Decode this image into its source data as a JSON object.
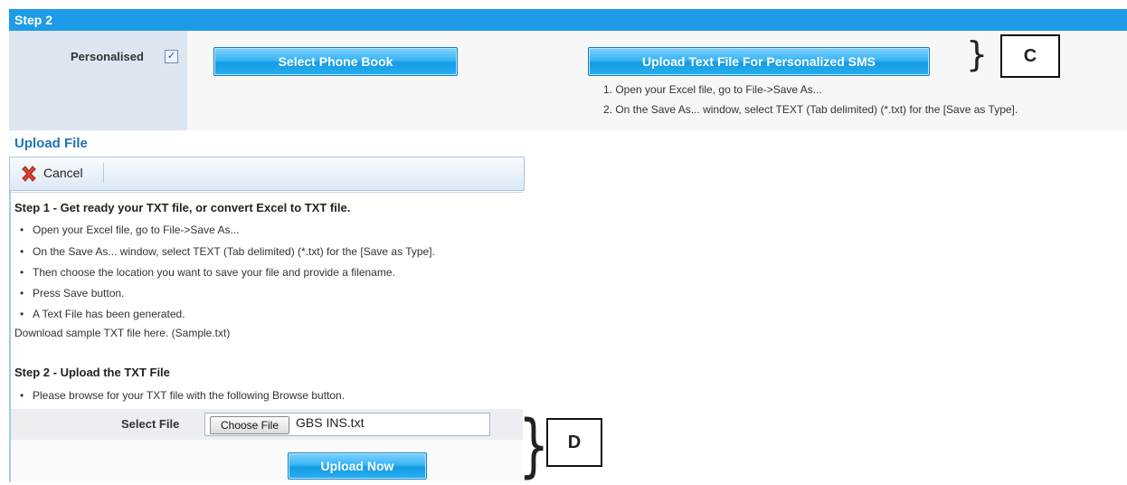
{
  "step2": {
    "title": "Step 2",
    "personalised_label": "Personalised",
    "personalised_checked": "✓",
    "select_phonebook_label": "Select Phone Book",
    "upload_sms_label": "Upload Text File For Personalized SMS",
    "notes": [
      "1. Open your Excel file, go to File->Save As...",
      "2. On the Save As... window, select TEXT (Tab delimited) (*.txt) for the [Save as Type]."
    ]
  },
  "callouts": {
    "c": "C",
    "d": "D"
  },
  "upload_file": {
    "title": "Upload File",
    "cancel_label": "Cancel",
    "step1_heading": "Step 1 - Get ready your TXT file, or convert Excel to TXT file.",
    "step1_items": [
      "Open your Excel file, go to File->Save As...",
      "On the Save As... window, select TEXT (Tab delimited) (*.txt) for the [Save as Type].",
      "Then choose the location you want to save your file and provide a filename.",
      "Press Save button.",
      "A Text File has been generated."
    ],
    "download_text": "Download sample TXT file here. (Sample.txt)",
    "step2_heading": "Step 2 - Upload the TXT File",
    "step2_items": [
      "Please browse for your TXT file with the following Browse button."
    ],
    "select_file_label": "Select File",
    "choose_file_label": "Choose File",
    "file_name": "GBS INS.txt",
    "upload_now_label": "Upload Now"
  },
  "colors": {
    "header_blue": "#1e9be6",
    "title_blue": "#1f75b6",
    "button_blue": "#29aef0"
  }
}
